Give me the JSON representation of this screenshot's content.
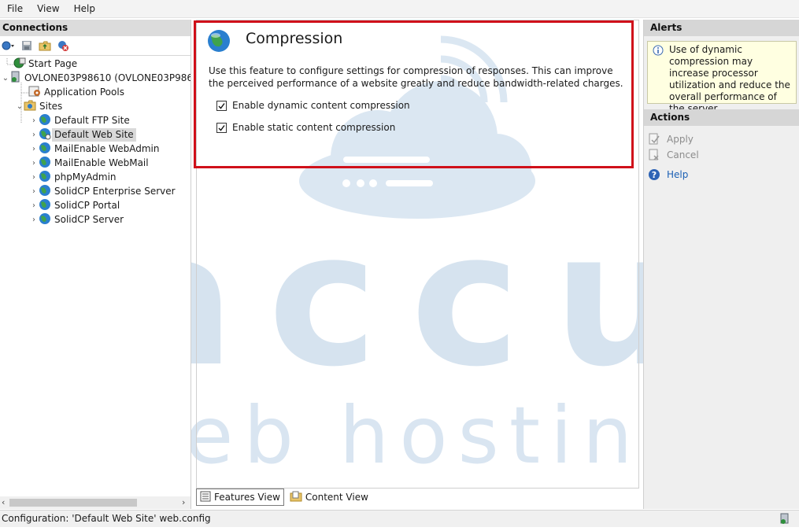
{
  "menu": {
    "items": [
      "File",
      "View",
      "Help"
    ]
  },
  "connections": {
    "title": "Connections",
    "tree": [
      {
        "label": "Start Page",
        "icon": "start-page-icon"
      },
      {
        "label": "OVLONE03P98610 (OVLONE03P98610\\",
        "icon": "server-icon"
      },
      {
        "label": "Application Pools",
        "icon": "app-pools-icon"
      },
      {
        "label": "Sites",
        "icon": "sites-folder-icon"
      },
      {
        "label": "Default FTP Site",
        "icon": "globe-icon"
      },
      {
        "label": "Default Web Site",
        "icon": "globe-icon"
      },
      {
        "label": "MailEnable WebAdmin",
        "icon": "globe-icon"
      },
      {
        "label": "MailEnable WebMail",
        "icon": "globe-icon"
      },
      {
        "label": "phpMyAdmin",
        "icon": "globe-icon"
      },
      {
        "label": "SolidCP Enterprise Server",
        "icon": "globe-icon"
      },
      {
        "label": "SolidCP Portal",
        "icon": "globe-icon"
      },
      {
        "label": "SolidCP Server",
        "icon": "globe-icon"
      }
    ]
  },
  "feature": {
    "title": "Compression",
    "description": "Use this feature to configure settings for compression of responses. This can improve the perceived performance of a website greatly and reduce bandwidth-related charges.",
    "options": [
      {
        "label": "Enable dynamic content compression",
        "checked": true
      },
      {
        "label": "Enable static content compression",
        "checked": true
      }
    ]
  },
  "view_tabs": {
    "features": "Features View",
    "content": "Content View"
  },
  "alerts": {
    "title": "Alerts",
    "message": "Use of dynamic compression may increase processor utilization and reduce the overall performance of the server."
  },
  "actions": {
    "title": "Actions",
    "apply": "Apply",
    "cancel": "Cancel",
    "help": "Help"
  },
  "status": {
    "text": "Configuration: 'Default Web Site' web.config"
  },
  "watermark": {
    "brand": "accu",
    "tagline": "web hosting"
  },
  "colors": {
    "highlight_frame": "#d0101a",
    "watermark": "#dbe7f2",
    "alert_bg": "#ffffe1"
  }
}
